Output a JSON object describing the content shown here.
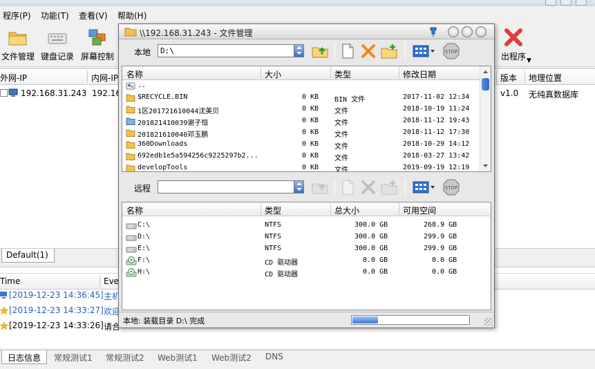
{
  "menubar": {
    "items": [
      "程序(P)",
      "功能(T)",
      "查看(V)",
      "帮助(H)"
    ]
  },
  "toolbar": {
    "buttons": [
      {
        "label": "文件管理",
        "icon": "folder-icon"
      },
      {
        "label": "键盘记录",
        "icon": "keyboard-icon"
      },
      {
        "label": "屏幕控制",
        "icon": "screen-icon"
      },
      {
        "label": "出程序",
        "icon": "exit-icon"
      }
    ]
  },
  "host_table": {
    "columns": [
      "外网-IP",
      "内网-IP",
      "版本",
      "地理位置"
    ],
    "rows": [
      {
        "wan_ip": "192.168.31.243",
        "lan_ip": "192.16",
        "version": "v1.0",
        "location": "无纯真数据库"
      }
    ]
  },
  "group_tabs": [
    "Default(1)"
  ],
  "log": {
    "columns": [
      "Time",
      "Eve"
    ],
    "rows": [
      {
        "time": "[2019-12-23 14:36:45]",
        "event": "主机",
        "color": "#1f5fbf",
        "icon": "host-icon"
      },
      {
        "time": "[2019-12-23 14:33:27]",
        "event": "欢迎",
        "color": "#1f5fbf",
        "icon": "star-icon"
      },
      {
        "time": "[2019-12-23 14:33:26]",
        "event": "请合",
        "color": "#000000",
        "icon": "star-icon"
      }
    ]
  },
  "bottom_tabs": [
    "日志信息",
    "常规测试1",
    "常规测试2",
    "Web测试1",
    "Web测试2",
    "DNS"
  ],
  "file_manager": {
    "title": "\\\\192.168.31.243 - 文件管理",
    "local": {
      "label": "本地",
      "path": "D:\\",
      "columns": [
        "名称",
        "大小",
        "类型",
        "修改日期"
      ],
      "files": [
        {
          "name": "..",
          "size": "",
          "type": "",
          "date": "",
          "icon": "parent-dir-icon"
        },
        {
          "name": "$RECYCLE.BIN",
          "size": "0 KB",
          "type": "BIN 文件",
          "date": "2017-11-02 12:34",
          "icon": "folder-icon"
        },
        {
          "name": "1区201721610044沈美贝",
          "size": "0 KB",
          "type": "文件",
          "date": "2018-10-19 11:24",
          "icon": "folder-icon"
        },
        {
          "name": "201821410039谢子恒",
          "size": "0 KB",
          "type": "文件",
          "date": "2018-11-12 19:43",
          "icon": "folder-special-icon"
        },
        {
          "name": "201821610040邓玉鹏",
          "size": "0 KB",
          "type": "文件",
          "date": "2018-11-12 17:30",
          "icon": "folder-icon"
        },
        {
          "name": "360Downloads",
          "size": "0 KB",
          "type": "文件",
          "date": "2018-10-29 14:12",
          "icon": "folder-icon"
        },
        {
          "name": "692edb1e5a594256c9225297b2...",
          "size": "0 KB",
          "type": "文件",
          "date": "2018-03-27 13:42",
          "icon": "folder-icon"
        },
        {
          "name": "developTools",
          "size": "0 KB",
          "type": "文件",
          "date": "2019-09-19 12:19",
          "icon": "folder-icon"
        }
      ]
    },
    "remote": {
      "label": "远程",
      "path": "",
      "columns": [
        "名称",
        "类型",
        "总大小",
        "可用空间"
      ],
      "drives": [
        {
          "name": "C:\\",
          "type": "NTFS",
          "total": "300.0 GB",
          "free": "268.9 GB",
          "icon": "hard-drive-icon"
        },
        {
          "name": "D:\\",
          "type": "NTFS",
          "total": "300.0 GB",
          "free": "299.9 GB",
          "icon": "hard-drive-icon"
        },
        {
          "name": "E:\\",
          "type": "NTFS",
          "total": "300.0 GB",
          "free": "299.9 GB",
          "icon": "hard-drive-icon"
        },
        {
          "name": "F:\\",
          "type": "CD 驱动器",
          "total": "0.0 GB",
          "free": "0.0 GB",
          "icon": "cd-drive-icon"
        },
        {
          "name": "H:\\",
          "type": "CD 驱动器",
          "total": "0.0 GB",
          "free": "0.0 GB",
          "icon": "cd-drive-icon"
        }
      ]
    },
    "status": "本地: 装载目录 D:\\ 完成",
    "progress_fraction": 0.22
  }
}
